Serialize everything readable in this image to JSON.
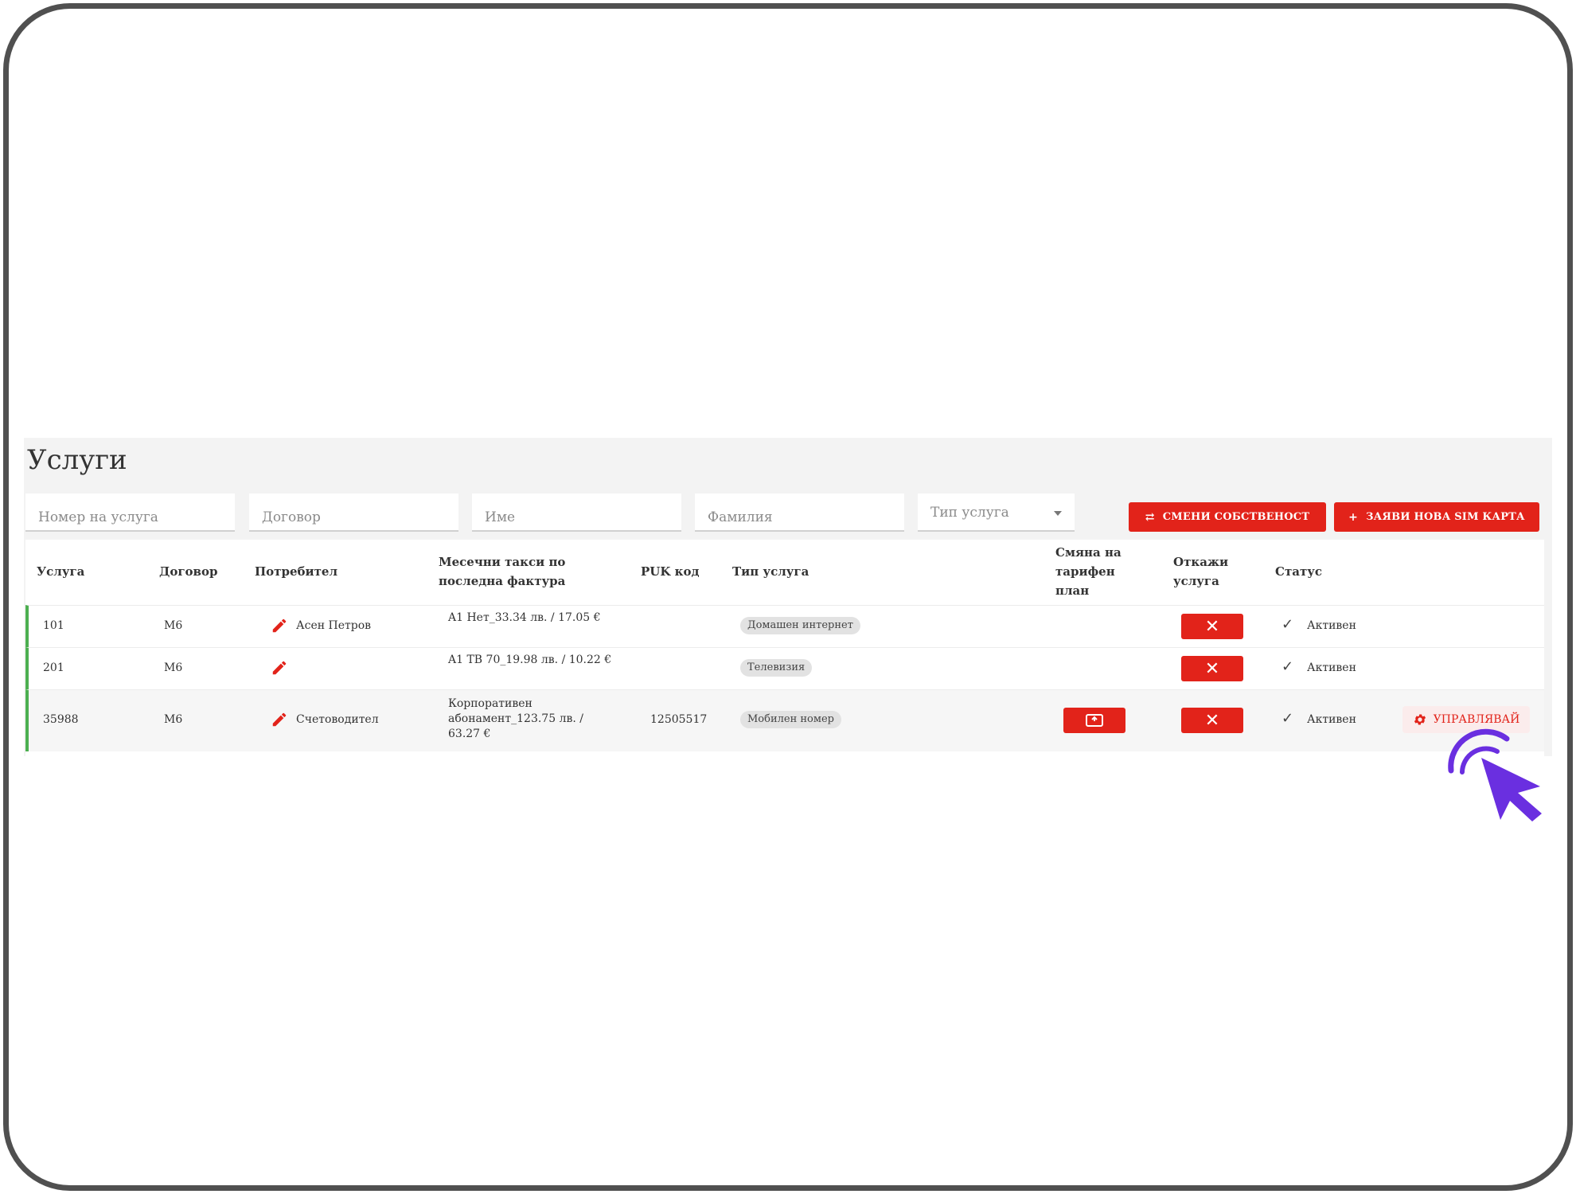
{
  "page": {
    "title": "Услуги"
  },
  "filters": {
    "service_number": "Номер на услуга",
    "contract": "Договор",
    "first_name": "Име",
    "last_name": "Фамилия",
    "service_type": "Тип услуга"
  },
  "actions": {
    "change_ownership": "СМЕНИ СОБСТВЕНОСТ",
    "request_sim": "ЗАЯВИ НОВА SIM КАРТА"
  },
  "table": {
    "headers": {
      "service": "Услуга",
      "contract": "Договор",
      "user": "Потребител",
      "monthly_fees": "Месечни такси по последна фактура",
      "puk": "PUK код",
      "service_type": "Тип услуга",
      "change_plan": "Смяна на тарифен план",
      "cancel": "Откажи услуга",
      "status": "Статус"
    },
    "rows": [
      {
        "service": "101",
        "contract": "M6",
        "user": "Асен Петров",
        "monthly": "A1 Нет_33.34 лв. / 17.05 €",
        "puk": "",
        "type": "Домашен интернет",
        "status": "Активен"
      },
      {
        "service": "201",
        "contract": "M6",
        "user": "",
        "monthly": "A1 ТВ 70_19.98 лв. / 10.22 €",
        "puk": "",
        "type": "Телевизия",
        "status": "Активен"
      },
      {
        "service": "35988",
        "contract": "M6",
        "user": "Счетоводител",
        "monthly": "Корпоративен абонамент_123.75 лв. / 63.27 €",
        "puk": "12505517",
        "type": "Мобилен номер",
        "status": "Активен",
        "manage": "УПРАВЛЯВАЙ"
      }
    ]
  },
  "colors": {
    "accent": "#e2231a",
    "active": "#4caf50",
    "cursor": "#6a2fe0"
  },
  "icons": {
    "edit": "pencil-icon",
    "cancel": "close-icon",
    "plan": "plan-change-icon",
    "status": "check-icon",
    "manage": "gear-icon",
    "cursor": "pointer-cursor-icon"
  }
}
